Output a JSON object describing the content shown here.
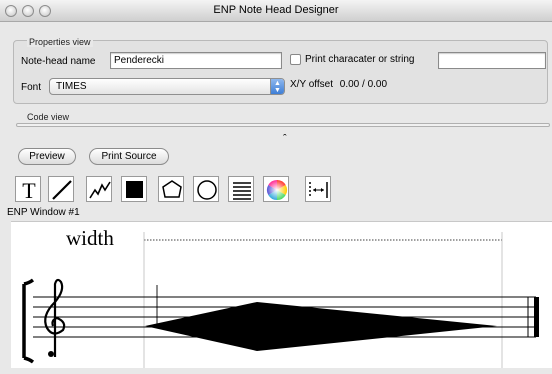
{
  "window": {
    "title": "ENP Note Head Designer"
  },
  "properties": {
    "group_label": "Properties view",
    "note_head_name_label": "Note-head name",
    "note_head_name_value": "Penderecki",
    "print_checkbox_label": "Print characater or string",
    "print_checkbox_checked": false,
    "print_string_value": "",
    "font_label": "Font",
    "font_value": "TIMES",
    "offset_label": "X/Y offset",
    "offset_value": "0.00 / 0.00"
  },
  "code_view": {
    "group_label": "Code view",
    "collapse_glyph": "ˆ"
  },
  "buttons": {
    "preview": "Preview",
    "print_source": "Print Source"
  },
  "tools": [
    {
      "name": "text-tool",
      "icon": "text-T-icon",
      "glyph": "T"
    },
    {
      "name": "line-tool",
      "icon": "line-icon"
    },
    {
      "name": "polyline-tool",
      "icon": "polyline-icon"
    },
    {
      "name": "filled-rect-tool",
      "icon": "filled-square-icon"
    },
    {
      "name": "polygon-tool",
      "icon": "pentagon-icon"
    },
    {
      "name": "circle-tool",
      "icon": "circle-icon"
    },
    {
      "name": "lines-tool",
      "icon": "horizontal-lines-icon"
    },
    {
      "name": "color-tool",
      "icon": "color-wheel-icon"
    },
    {
      "name": "width-tool",
      "icon": "width-arrows-icon"
    }
  ],
  "enp_window": {
    "label": "ENP Window #1",
    "width_text": "width"
  },
  "colors": {
    "note_head_fill": "#000000",
    "staff_line": "#000000"
  }
}
